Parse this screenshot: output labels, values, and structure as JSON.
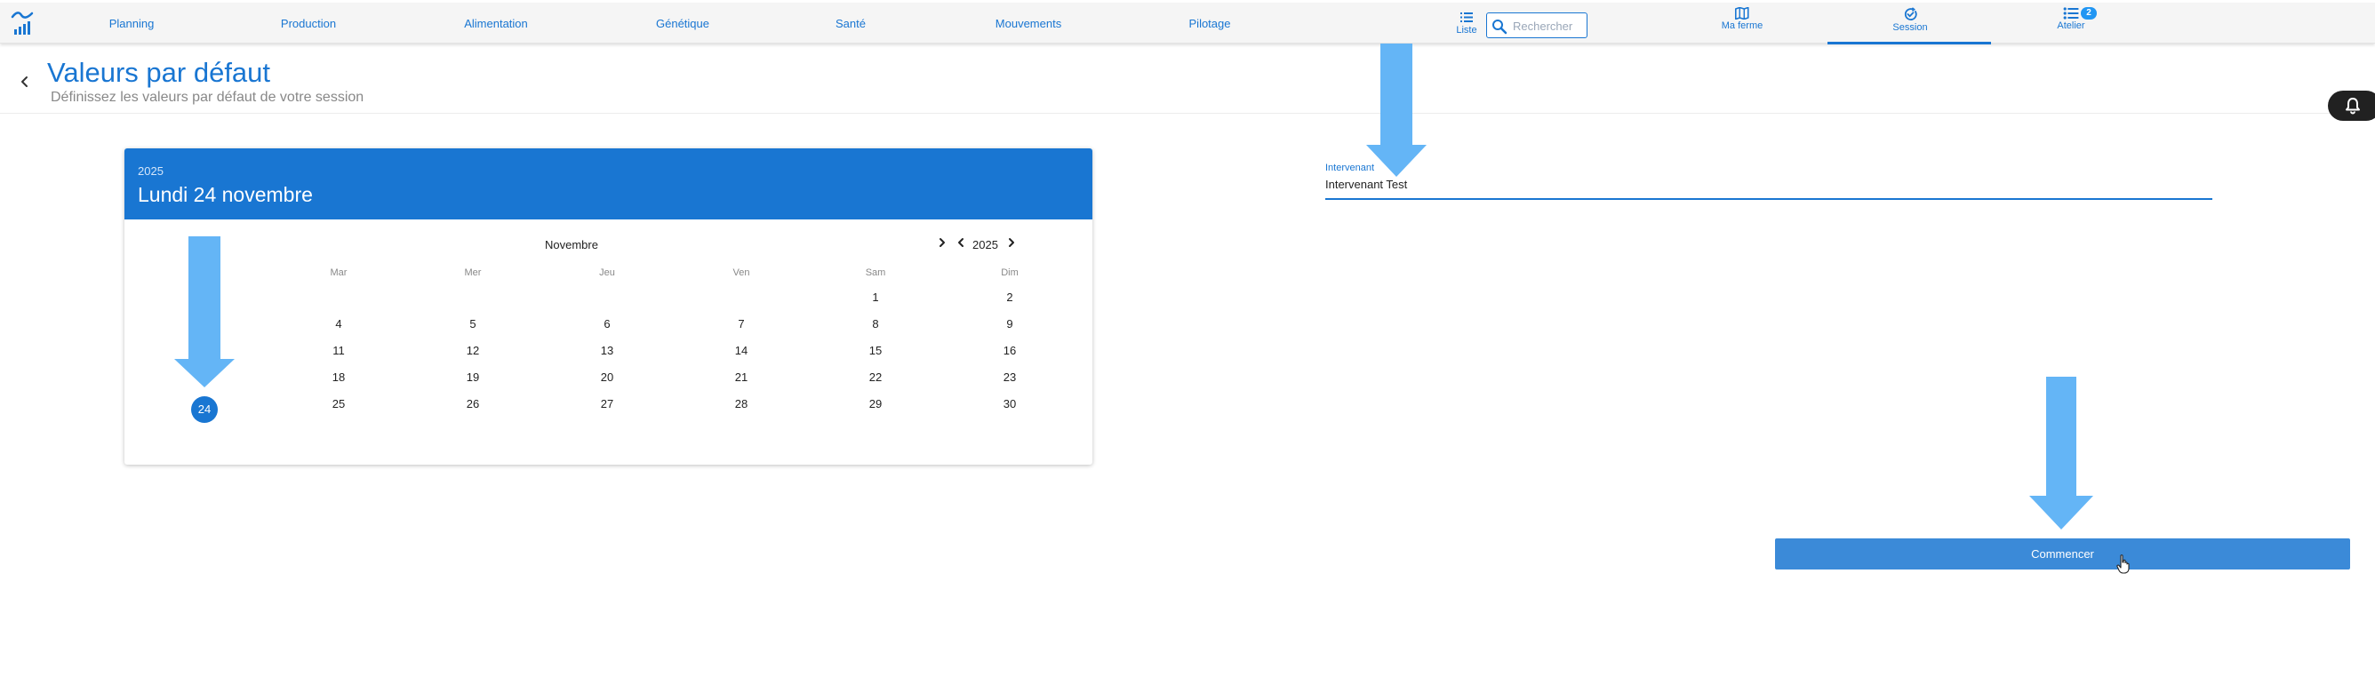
{
  "nav": {
    "items": [
      "Planning",
      "Production",
      "Alimentation",
      "Génétique",
      "Santé",
      "Mouvements",
      "Pilotage"
    ],
    "list_label": "Liste",
    "search_placeholder": "Rechercher",
    "tools": [
      {
        "label": "Ma ferme",
        "icon": "map-icon"
      },
      {
        "label": "Session",
        "icon": "session-check-icon",
        "active": true
      },
      {
        "label": "Atelier",
        "icon": "list-icon",
        "badge": "2"
      }
    ],
    "accent_color": "#1976d2"
  },
  "header": {
    "title": "Valeurs par défaut",
    "subtitle": "Définissez les valeurs par défaut de votre session"
  },
  "calendar": {
    "year": "2025",
    "selected_label": "Lundi 24 novembre",
    "month": "Novembre",
    "nav_year": "2025",
    "weekdays": [
      "Mar",
      "Mer",
      "Jeu",
      "Ven",
      "Sam",
      "Dim"
    ],
    "selected_day": "24",
    "weeks": [
      [
        "",
        "",
        "",
        "",
        "1",
        "2"
      ],
      [
        "4",
        "5",
        "6",
        "7",
        "8",
        "9"
      ],
      [
        "11",
        "12",
        "13",
        "14",
        "15",
        "16"
      ],
      [
        "18",
        "19",
        "20",
        "21",
        "22",
        "23"
      ],
      [
        "25",
        "26",
        "27",
        "28",
        "29",
        "30"
      ]
    ]
  },
  "form": {
    "intervenant_label": "Intervenant",
    "intervenant_value": "Intervenant Test",
    "start_label": "Commencer"
  }
}
